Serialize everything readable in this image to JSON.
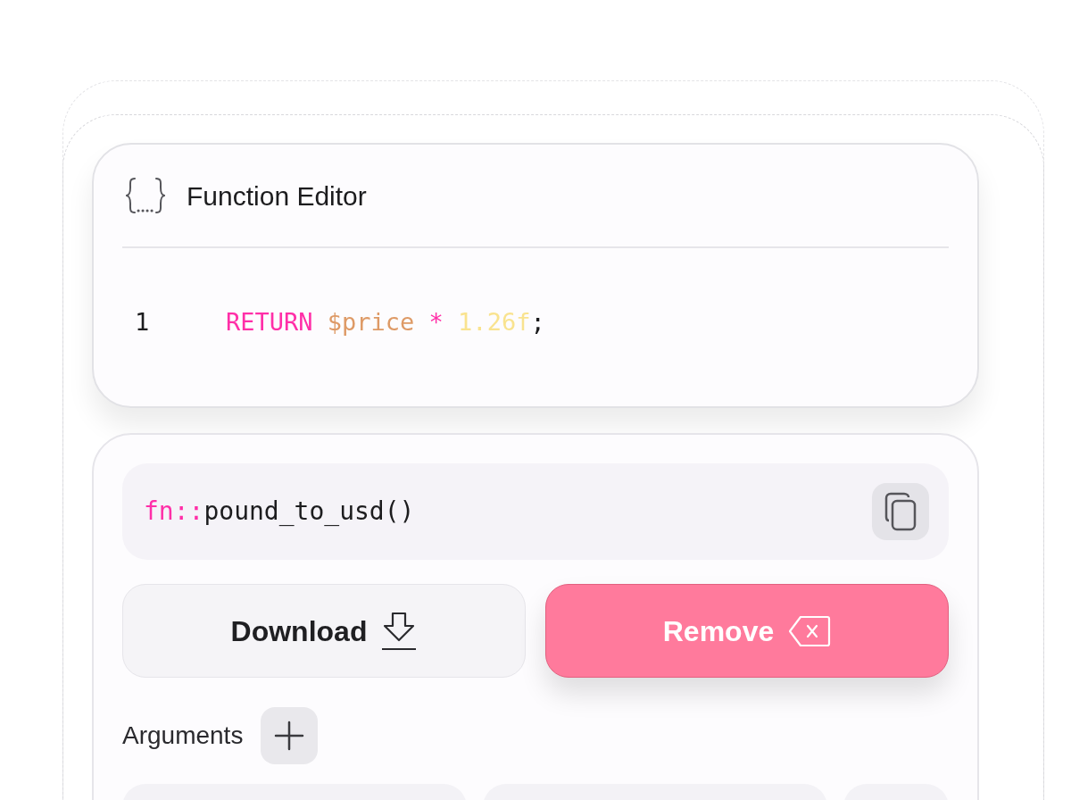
{
  "editor": {
    "title": "Function Editor",
    "lines": [
      {
        "number": "1",
        "tokens": [
          {
            "kind": "keyword",
            "text": "RETURN"
          },
          {
            "kind": "variable",
            "text": "$price"
          },
          {
            "kind": "operator",
            "text": "*"
          },
          {
            "kind": "number",
            "text": "1.26f"
          },
          {
            "kind": "punctuation",
            "text": ";"
          }
        ]
      }
    ]
  },
  "signature": {
    "prefix": "fn::",
    "name": "pound_to_usd()"
  },
  "buttons": [
    {
      "kind": "download",
      "label": "Download"
    },
    {
      "kind": "remove",
      "label": "Remove"
    }
  ],
  "arguments": {
    "label": "Arguments",
    "items": [
      {
        "kind": "chip"
      },
      {
        "kind": "chip"
      },
      {
        "kind": "chip"
      }
    ]
  }
}
